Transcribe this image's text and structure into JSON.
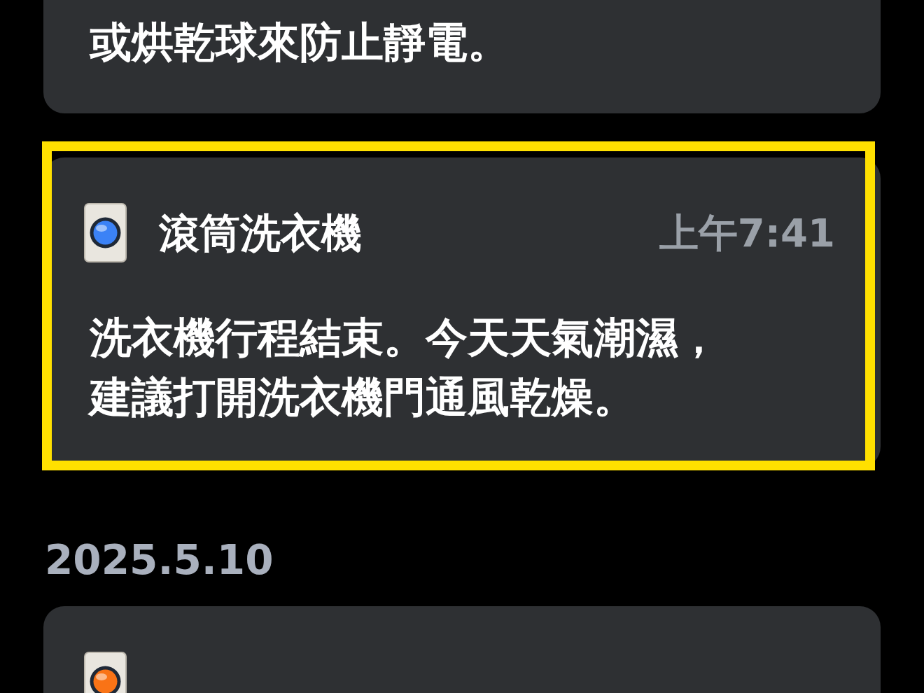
{
  "top_card": {
    "body": "或烘乾球來防止靜電。"
  },
  "notifications": [
    {
      "app": "滾筒洗衣機",
      "time": "上午7:41",
      "color": "#3b82f6",
      "highlighted": true,
      "body_lines": [
        "洗衣機行程結束。今天天氣潮濕，",
        "建議打開洗衣機門通風乾燥。"
      ]
    },
    {
      "color": "#f97316",
      "highlighted": false
    }
  ],
  "date_headers": [
    "2025.5.10"
  ]
}
